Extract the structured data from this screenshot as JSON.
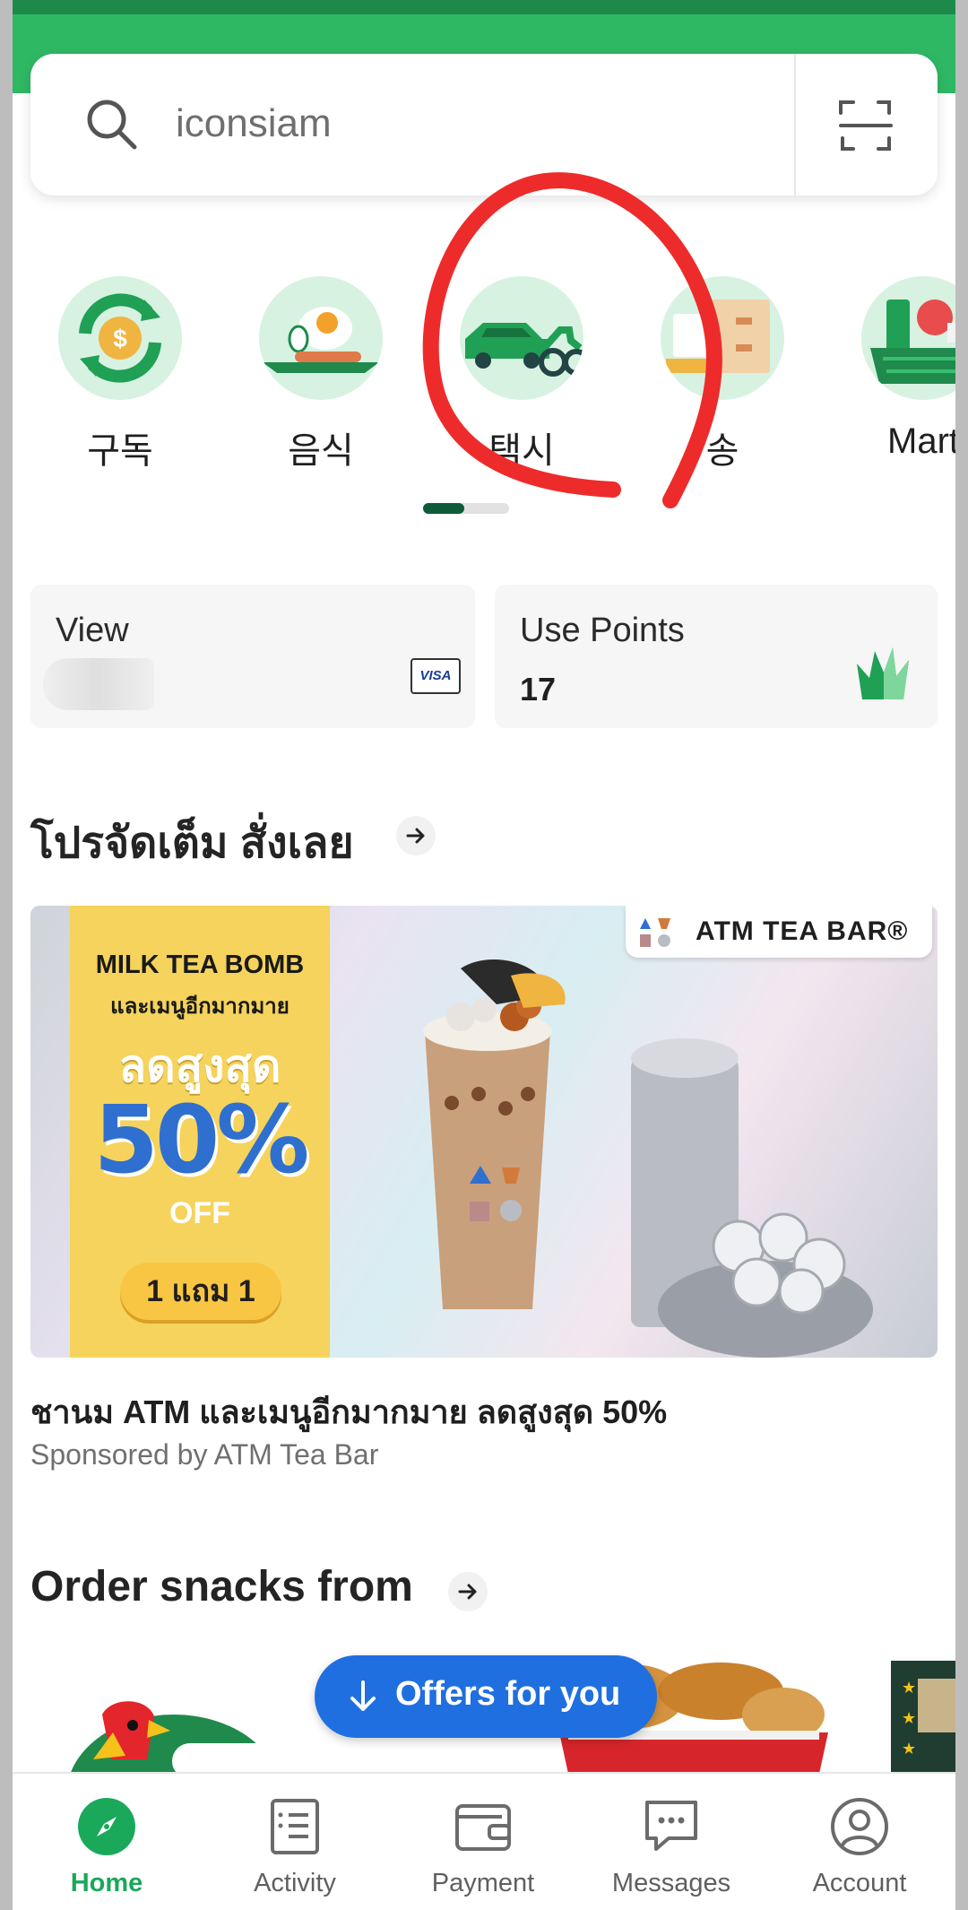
{
  "search": {
    "placeholder": "iconsiam"
  },
  "categories": [
    {
      "label": "구독",
      "icon": "subscription-icon"
    },
    {
      "label": "음식",
      "icon": "food-icon"
    },
    {
      "label": "택시",
      "icon": "taxi-icon"
    },
    {
      "label": "송",
      "icon": "delivery-icon"
    },
    {
      "label": "Mart",
      "icon": "mart-icon"
    }
  ],
  "cards": {
    "payment_title": "View",
    "payment_brand": "VISA",
    "points_title": "Use Points",
    "points_value": "17"
  },
  "promo_section": {
    "title": "โปรจัดเต็ม สั่งเลย",
    "banner": {
      "line1": "MILK TEA BOMB",
      "line2": "และเมนูอีกมากมาย",
      "line3": "ลดสูงสุด",
      "discount": "50%",
      "off": "OFF",
      "deal": "1 แถม 1",
      "brand": "ATM TEA BAR®"
    },
    "item_title": "ชานม ATM และเมนูอีกมากมาย ลดสูงสุด 50%",
    "item_sponsor": "Sponsored by ATM Tea Bar"
  },
  "snacks_section": {
    "title": "Order snacks from"
  },
  "fab": {
    "label": "Offers for you"
  },
  "bottom_nav": [
    {
      "label": "Home",
      "icon": "compass-icon",
      "active": true
    },
    {
      "label": "Activity",
      "icon": "activity-icon",
      "active": false
    },
    {
      "label": "Payment",
      "icon": "wallet-icon",
      "active": false
    },
    {
      "label": "Messages",
      "icon": "messages-icon",
      "active": false
    },
    {
      "label": "Account",
      "icon": "account-icon",
      "active": false
    }
  ],
  "colors": {
    "brand_green": "#2fb864",
    "active_nav": "#1aa85a",
    "fab_blue": "#1f6fe0",
    "annotation_red": "#ee2b2b"
  }
}
